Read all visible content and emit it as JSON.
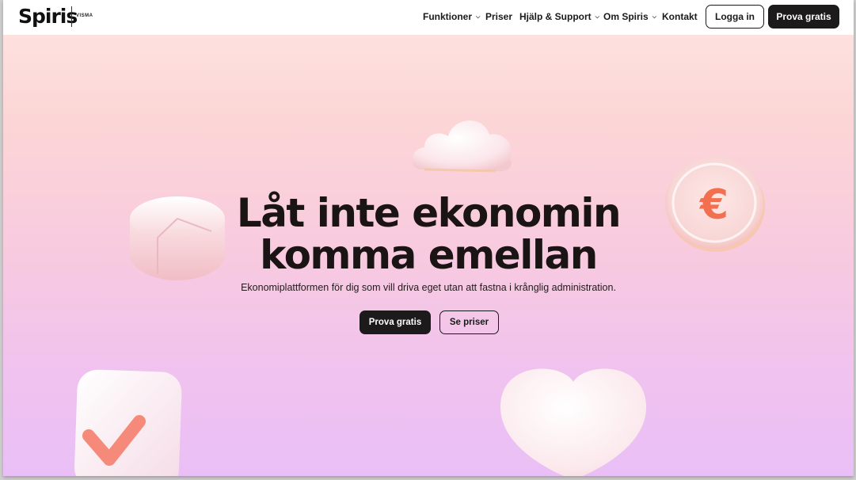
{
  "header": {
    "logo": "Spiris",
    "brand_sub": "VISMA",
    "nav": [
      {
        "label": "Funktioner",
        "has_dropdown": true
      },
      {
        "label": "Priser",
        "has_dropdown": false
      },
      {
        "label": "Hjälp & Support",
        "has_dropdown": true
      },
      {
        "label": "Om Spiris",
        "has_dropdown": true
      },
      {
        "label": "Kontakt",
        "has_dropdown": false
      }
    ],
    "login_label": "Logga in",
    "try_label": "Prova gratis"
  },
  "hero": {
    "title_line1": "Låt inte ekonomin",
    "title_line2": "komma emellan",
    "subtitle": "Ekonomiplattformen för dig som vill driva eget utan att fastna i krånglig administration.",
    "primary_label": "Prova gratis",
    "secondary_label": "Se priser",
    "coin_symbol": "€"
  },
  "icons": [
    "cloud-icon",
    "pie-chart-icon",
    "euro-coin-icon",
    "checkmark-card-icon",
    "heart-icon",
    "chevron-down-icon"
  ],
  "colors": {
    "accent_dark": "#1c1a1a",
    "bg_top": "#fde1de",
    "bg_bottom": "#e9bff6",
    "coin_accent": "#f2704f"
  }
}
